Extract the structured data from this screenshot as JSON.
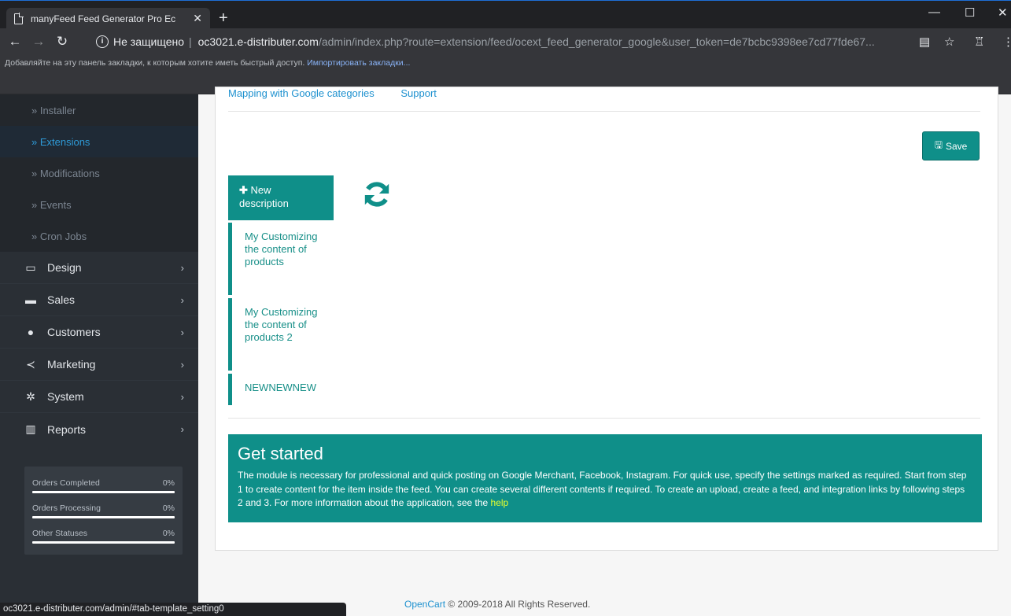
{
  "browser": {
    "tab_title": "manyFeed Feed Generator Pro Ec",
    "tab_close": "✕",
    "new_tab": "+",
    "security_label": "Не защищено",
    "url_domain": "oc3021.e-distributer.com",
    "url_path": "/admin/index.php?route=extension/feed/ocext_feed_generator_google&user_token=de7bcbc9398ee7cd77fde67...",
    "bookmarks_text": "Добавляйте на эту панель закладки, к которым хотите иметь быстрый доступ.",
    "bookmarks_link": "Импортировать закладки..."
  },
  "sidebar": {
    "subitems": [
      {
        "label": "» Installer"
      },
      {
        "label": "» Extensions"
      },
      {
        "label": "» Modifications"
      },
      {
        "label": "» Events"
      },
      {
        "label": "» Cron Jobs"
      }
    ],
    "menu": [
      {
        "label": "Design",
        "icon": "desktop-icon"
      },
      {
        "label": "Sales",
        "icon": "cart-icon"
      },
      {
        "label": "Customers",
        "icon": "user-icon"
      },
      {
        "label": "Marketing",
        "icon": "share-icon"
      },
      {
        "label": "System",
        "icon": "gear-icon"
      },
      {
        "label": "Reports",
        "icon": "bar-chart-icon"
      }
    ],
    "stats": [
      {
        "label": "Orders Completed",
        "value": "0%"
      },
      {
        "label": "Orders Processing",
        "value": "0%"
      },
      {
        "label": "Other Statuses",
        "value": "0%"
      }
    ]
  },
  "main": {
    "tabs": [
      "Mapping with Google categories",
      "Support"
    ],
    "save_label": "Save",
    "new_description_label": "New description",
    "descriptions": [
      "My Customizing the content of products",
      "My Customizing the content of products 2",
      "NEWNEWNEW"
    ],
    "get_started": {
      "title": "Get started",
      "text": "The module is necessary for professional and quick posting on Google Merchant, Facebook, Instagram. For quick use, specify the settings marked as required. Start from step 1 to create content for the item inside the feed. You can create several different contents if required. To create an upload, create a feed, and integration links by following steps 2 and 3. For more information about the application, see the",
      "link": "help"
    }
  },
  "footer": {
    "link": "OpenCart",
    "text": "© 2009-2018 All Rights Reserved."
  },
  "status_bar": "oc3021.e-distributer.com/admin/#tab-template_setting0",
  "colors": {
    "accent": "#0f8f89",
    "sidebar": "#2a2f35",
    "link": "#1e91cf"
  }
}
